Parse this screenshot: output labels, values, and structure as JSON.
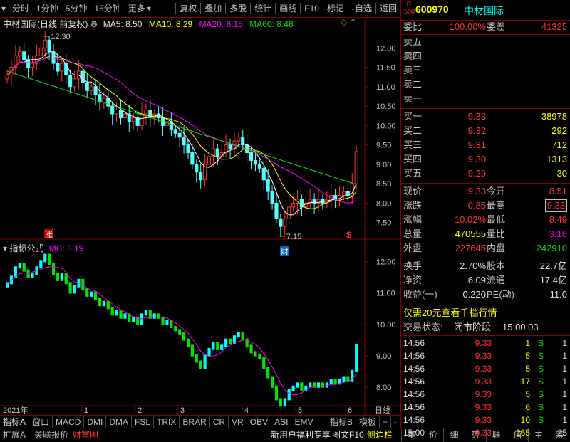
{
  "toolbar": {
    "periods": [
      "分时",
      "1分钟",
      "5分钟",
      "15分钟",
      "更多"
    ],
    "actions": [
      "复权",
      "叠加",
      "多股",
      "统计",
      "画线",
      "F10",
      "标记",
      "-自选",
      "返回"
    ]
  },
  "chart_header": {
    "title": "中材国际(日线 前复权)",
    "ma5": "MA5: 8.50",
    "ma10": "MA10: 8.29",
    "ma20": "MA20: 8.15",
    "ma60": "MA60: 8.48"
  },
  "price_axis": [
    "12.00",
    "11.50",
    "11.00",
    "10.50",
    "10.00",
    "9.50",
    "9.00",
    "8.50",
    "8.00",
    "7.50"
  ],
  "annotations": {
    "high": "12.30",
    "low": "7.15",
    "badge_zhang": "涨",
    "badge_cai": "财",
    "badge_s": "$"
  },
  "indicator_header": {
    "title": "指标公式",
    "mc": "MC: 8.19"
  },
  "indicator_axis": [
    "12.00",
    "11.00",
    "10.00",
    "9.00",
    "8.00"
  ],
  "date_axis": {
    "year": "2021年",
    "months": [
      "1",
      "2",
      "3",
      "4",
      "5",
      "6"
    ],
    "period": "日线"
  },
  "bottom_tabs": [
    "指标A",
    "窗口",
    "MACD",
    "DMI",
    "DMA",
    "FSL",
    "TRIX",
    "BRAR",
    "CR",
    "VR",
    "OBV",
    "ASI",
    "EMV",
    "指标B",
    "模板",
    "+",
    "-"
  ],
  "status_left": [
    "扩展A",
    "关联报价",
    "财富图"
  ],
  "status_mid": [
    "新用户福利专享",
    "图文F10",
    "侧边栏"
  ],
  "right_tabs": [
    "笔",
    "价",
    "细",
    "势",
    "联",
    "值",
    "主",
    "筹"
  ],
  "stock": {
    "code": "600970",
    "name": "中材国际",
    "badge_top": "R",
    "badge_bottom": "500"
  },
  "weibi": {
    "label": "委比",
    "value": "100.00%",
    "label2": "委差",
    "value2": "41325"
  },
  "sell": [
    {
      "label": "卖五"
    },
    {
      "label": "卖四"
    },
    {
      "label": "卖三"
    },
    {
      "label": "卖二"
    },
    {
      "label": "卖一"
    }
  ],
  "buy": [
    {
      "label": "买一",
      "price": "9.33",
      "vol": "38978"
    },
    {
      "label": "买二",
      "price": "9.32",
      "vol": "292"
    },
    {
      "label": "买三",
      "price": "9.31",
      "vol": "712"
    },
    {
      "label": "买四",
      "price": "9.30",
      "vol": "1313"
    },
    {
      "label": "买五",
      "price": "9.29",
      "vol": "30"
    }
  ],
  "quote": [
    {
      "l1": "现价",
      "v1": "9.33",
      "c1": "red",
      "l2": "今开",
      "v2": "8.51",
      "c2": "red"
    },
    {
      "l1": "涨跌",
      "v1": "0.85",
      "c1": "red",
      "l2": "最高",
      "v2": "9.33",
      "c2": "red"
    },
    {
      "l1": "涨幅",
      "v1": "10.02%",
      "c1": "red",
      "l2": "最低",
      "v2": "8.49",
      "c2": "red"
    },
    {
      "l1": "总量",
      "v1": "470555",
      "c1": "yel",
      "l2": "量比",
      "v2": "3.18",
      "c2": "mag"
    },
    {
      "l1": "外盘",
      "v1": "227645",
      "c1": "red",
      "l2": "内盘",
      "v2": "242910",
      "c2": "grn"
    }
  ],
  "fundamentals": [
    {
      "l1": "换手",
      "v1": "2.70%",
      "l2": "股本",
      "v2": "22.7亿"
    },
    {
      "l1": "净资",
      "v1": "6.09",
      "l2": "流通",
      "v2": "17.4亿"
    },
    {
      "l1": "收益(一)",
      "v1": "0.220",
      "l2": "PE(动)",
      "v2": "11.0"
    }
  ],
  "promo": "仅需20元查看千档行情",
  "trade_status": {
    "label": "交易状态:",
    "value": "闭市阶段",
    "time": "15:00:03"
  },
  "ticks": [
    {
      "time": "14:56",
      "price": "9.33",
      "vol": "1",
      "bs": "S",
      "n": "1"
    },
    {
      "time": "14:56",
      "price": "9.33",
      "vol": "5",
      "bs": "S",
      "n": "1"
    },
    {
      "time": "14:56",
      "price": "9.33",
      "vol": "5",
      "bs": "S",
      "n": "1"
    },
    {
      "time": "14:56",
      "price": "9.33",
      "vol": "17",
      "bs": "S",
      "n": "1"
    },
    {
      "time": "14:56",
      "price": "9.33",
      "vol": "5",
      "bs": "S",
      "n": "1"
    },
    {
      "time": "14:56",
      "price": "9.33",
      "vol": "6",
      "bs": "S",
      "n": "1"
    },
    {
      "time": "14:56",
      "price": "9.33",
      "vol": "10",
      "bs": "S",
      "n": "1"
    },
    {
      "time": "15:00",
      "price": "9.33",
      "vol": "265",
      "bs": "",
      "n": "25"
    }
  ],
  "chart_data": {
    "type": "candlestick",
    "price_ylim": [
      7.0,
      12.5
    ],
    "indicator_ylim": [
      7.5,
      12.4
    ],
    "dates_note": "daily bars Dec 2021 - Jun 2021 (approximate)",
    "close": [
      11.3,
      11.5,
      11.8,
      11.9,
      11.7,
      11.5,
      11.6,
      11.8,
      12.0,
      12.2,
      11.9,
      11.6,
      11.4,
      11.6,
      11.3,
      11.0,
      11.2,
      11.4,
      11.1,
      10.9,
      11.0,
      10.8,
      10.6,
      10.7,
      10.5,
      10.3,
      10.4,
      10.2,
      10.3,
      10.1,
      10.2,
      10.0,
      10.3,
      10.4,
      10.2,
      10.3,
      10.2,
      10.0,
      10.1,
      9.9,
      9.8,
      9.7,
      9.5,
      9.3,
      9.0,
      8.8,
      8.6,
      9.0,
      9.2,
      9.4,
      9.2,
      9.3,
      9.5,
      9.4,
      9.6,
      9.7,
      9.5,
      9.3,
      9.1,
      9.0,
      8.9,
      8.6,
      8.3,
      8.0,
      7.6,
      7.4,
      7.6,
      7.9,
      8.0,
      8.1,
      7.9,
      8.0,
      8.1,
      8.0,
      8.1,
      8.0,
      8.1,
      8.2,
      8.1,
      8.2,
      8.3,
      8.2,
      8.5,
      9.33
    ],
    "ma5_last": 8.5,
    "ma10_last": 8.29,
    "ma20_last": 8.15,
    "ma60_last": 8.48
  }
}
